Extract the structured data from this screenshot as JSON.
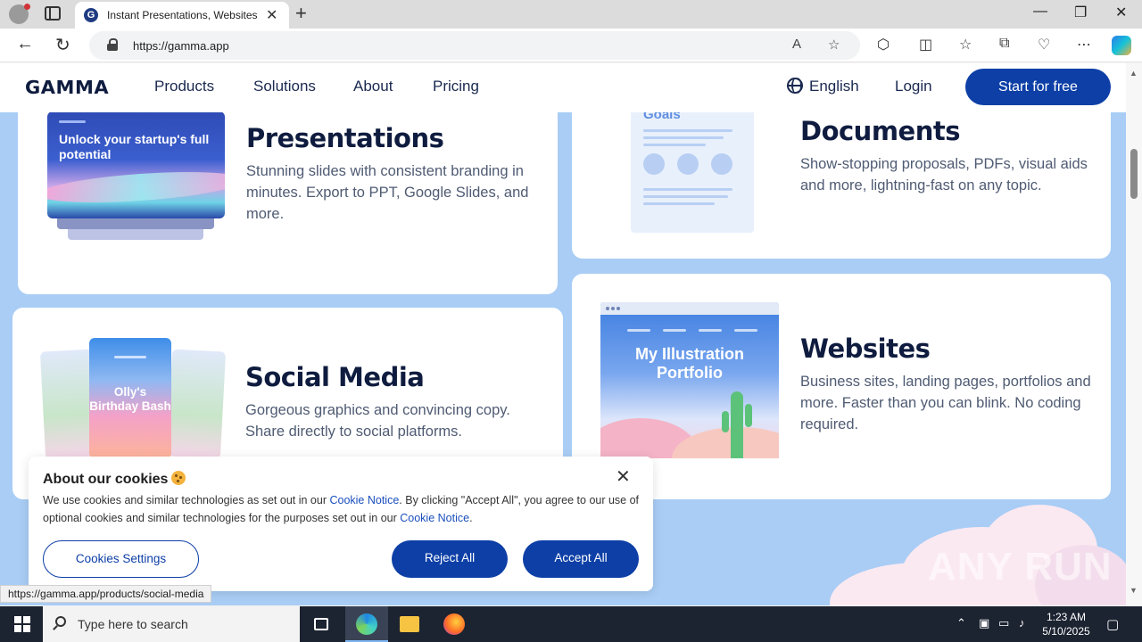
{
  "browser": {
    "tab_title": "Instant Presentations, Websites, and More | Gamma",
    "url": "https://gamma.app",
    "status_url": "https://gamma.app/products/social-media"
  },
  "site_nav": {
    "logo": "GAMMA",
    "links": [
      "Products",
      "Solutions",
      "About",
      "Pricing"
    ],
    "language": "English",
    "login": "Login",
    "cta": "Start for free"
  },
  "cards": {
    "presentations": {
      "title": "Presentations",
      "description": "Stunning slides with consistent branding in minutes. Export to PPT, Google Slides, and more.",
      "thumb_text": "Unlock your startup's full potential"
    },
    "documents": {
      "title": "Documents",
      "description": "Show-stopping proposals, PDFs, visual aids and more, lightning-fast on any topic.",
      "thumb_text": "Goals"
    },
    "social_media": {
      "title": "Social Media",
      "description": "Gorgeous graphics and convincing copy. Share directly to social platforms.",
      "thumb_text": "Olly's Birthday Bash"
    },
    "websites": {
      "title": "Websites",
      "description": "Business sites, landing pages, portfolios and more. Faster than you can blink. No coding required.",
      "thumb_text": "My Illustration Portfolio"
    }
  },
  "cookie_banner": {
    "title": "About our cookies",
    "text_1": "We use cookies and similar technologies as set out in our ",
    "link_1": "Cookie Notice",
    "text_2": ". By clicking \"Accept All\", you agree to our use of optional cookies and similar technologies for the purposes set out in our ",
    "link_2": "Cookie Notice",
    "text_3": ".",
    "settings_button": "Cookies Settings",
    "reject_button": "Reject All",
    "accept_button": "Accept All"
  },
  "watermark": "ANY RUN",
  "taskbar": {
    "search_placeholder": "Type here to search",
    "time": "1:23 AM",
    "date": "5/10/2025"
  },
  "colors": {
    "brand_navy": "#0d3fa6",
    "page_bg": "#a9cdf5",
    "heading": "#0f1c3f"
  }
}
